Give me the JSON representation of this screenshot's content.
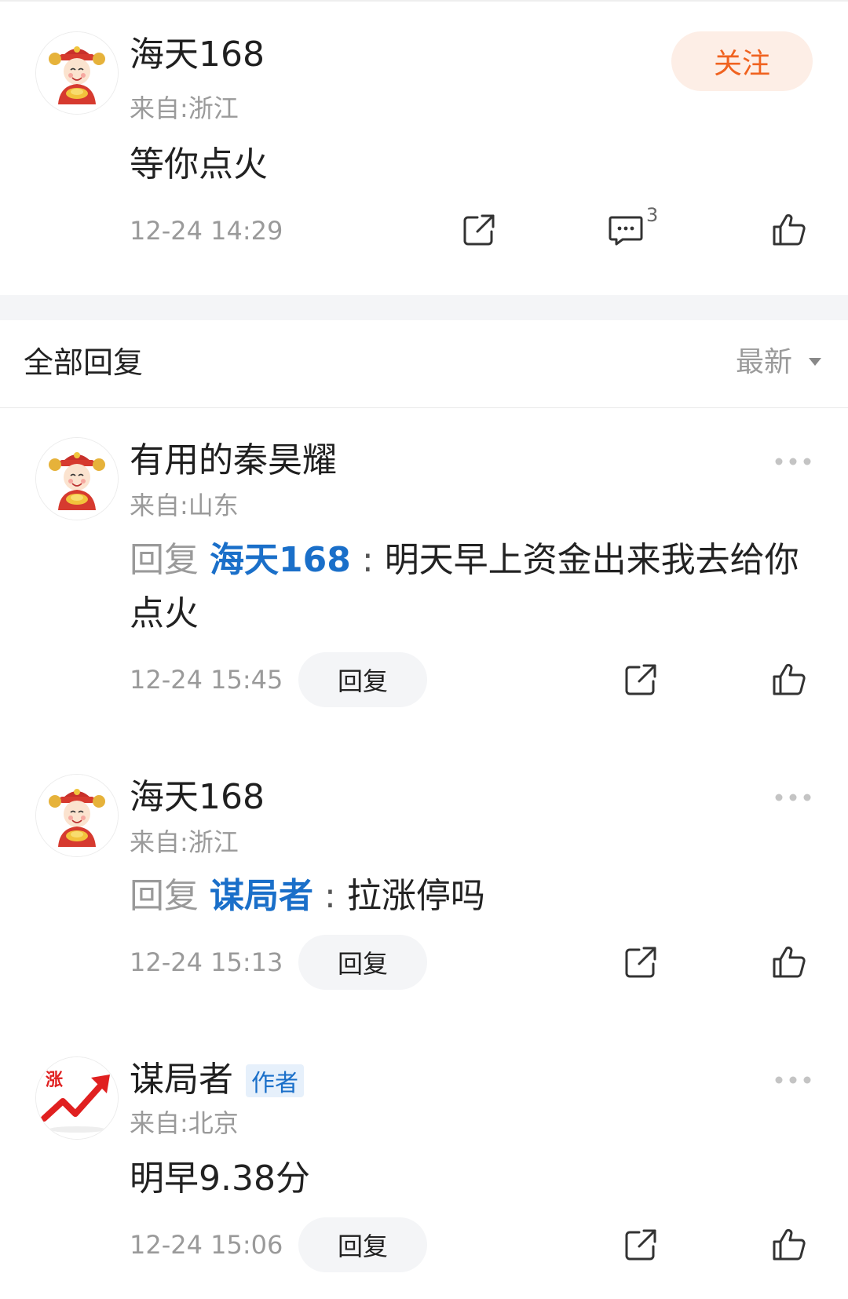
{
  "main_post": {
    "username": "海天168",
    "location": "来自:浙江",
    "content": "等你点火",
    "time": "12-24 14:29",
    "follow_label": "关注",
    "comment_count": "3"
  },
  "replies_header": {
    "title": "全部回复",
    "sort_label": "最新"
  },
  "replies": [
    {
      "username": "有用的秦昊耀",
      "location": "来自:山东",
      "reply_prefix": "回复",
      "mention": "海天168",
      "separator": ":",
      "content": "明天早上资金出来我去给你点火",
      "time": "12-24 15:45",
      "reply_label": "回复"
    },
    {
      "username": "海天168",
      "location": "来自:浙江",
      "reply_prefix": "回复",
      "mention": "谋局者",
      "separator": ":",
      "content": "拉涨停吗",
      "time": "12-24 15:13",
      "reply_label": "回复"
    },
    {
      "username": "谋局者",
      "badge": "作者",
      "location": "来自:北京",
      "content": "明早9.38分",
      "time": "12-24 15:06",
      "reply_label": "回复",
      "avatar_text": "涨"
    }
  ],
  "colors": {
    "mention": "#1a6fc9",
    "follow_text": "#f0621f",
    "follow_bg": "#fdeee6",
    "muted": "#9a9a9a"
  },
  "icons": [
    "share-icon",
    "comment-icon",
    "like-icon",
    "more-icon",
    "sort-arrow-icon"
  ]
}
